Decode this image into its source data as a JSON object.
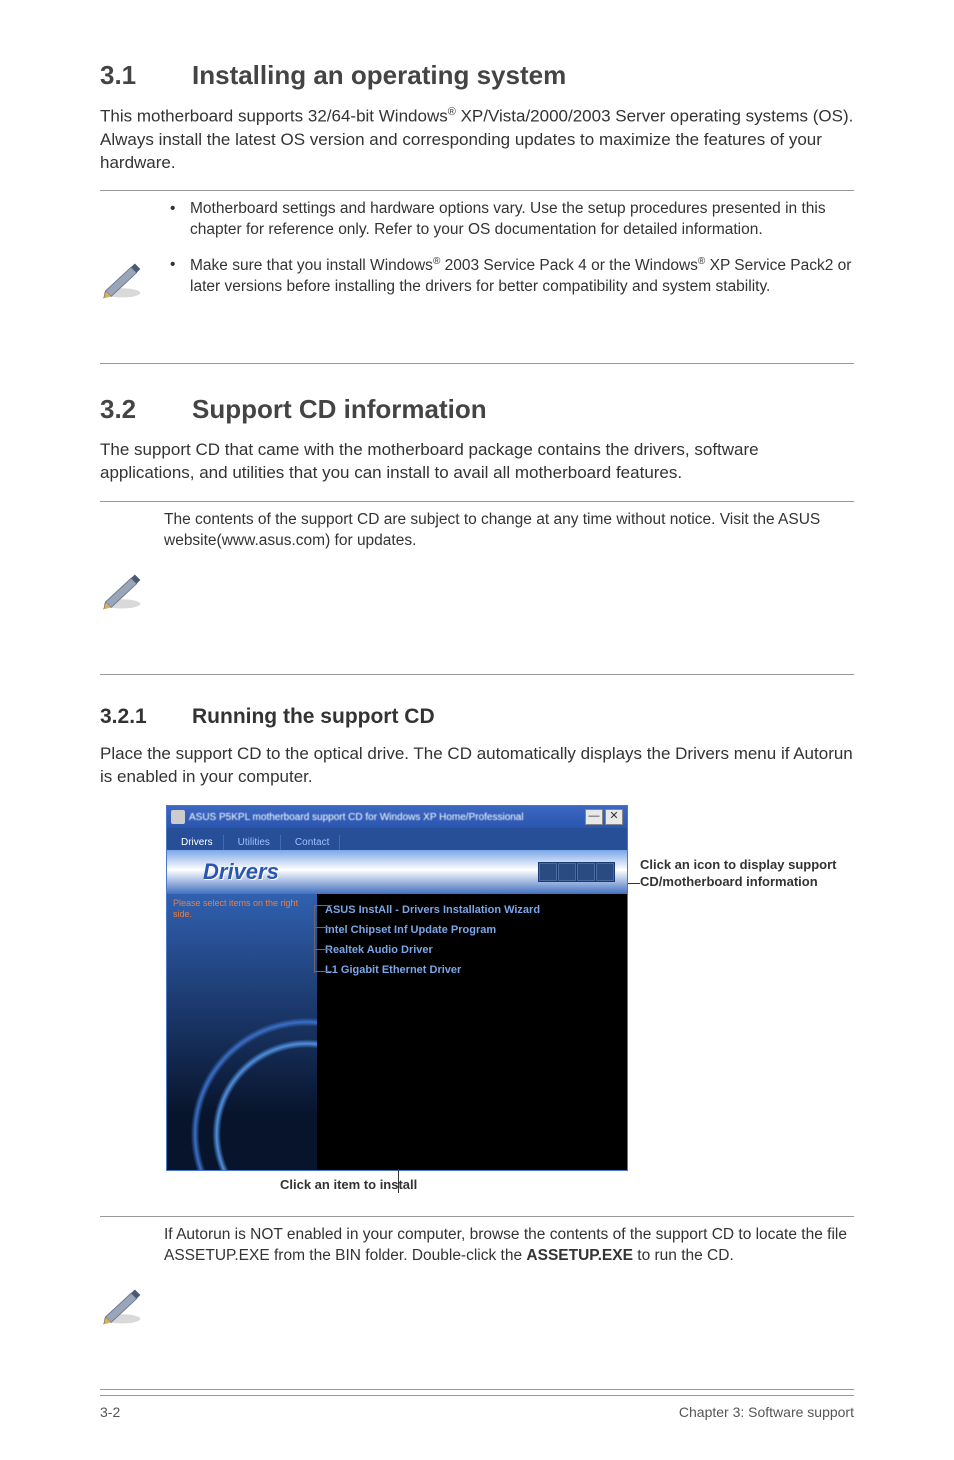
{
  "sec31": {
    "num": "3.1",
    "title": "Installing an operating system",
    "body_pre": "This motherboard supports 32/64-bit Windows",
    "body_post": " XP/Vista/2000/2003 Server operating systems (OS). Always install the latest OS version and corresponding updates to maximize the features of your hardware.",
    "note1": "Motherboard settings and hardware options vary. Use the setup procedures presented in this chapter for reference only. Refer to your OS documentation for detailed information.",
    "note2a": "Make sure that you install Windows",
    "note2b": " 2003 Service Pack 4 or the Windows",
    "note2c": " XP Service Pack2 or later versions before installing the drivers for better compatibility and system stability."
  },
  "sec32": {
    "num": "3.2",
    "title": "Support CD information",
    "body": "The support CD that came with the motherboard package contains the drivers, software applications, and utilities that you can install to avail all  motherboard features.",
    "note": "The contents of the support CD are subject to change at any time without notice. Visit the ASUS website(www.asus.com) for updates."
  },
  "sec321": {
    "num": "3.2.1",
    "title": "Running the support CD",
    "body": "Place the support CD to the optical drive. The CD automatically displays the Drivers menu if Autorun is enabled in your computer."
  },
  "window": {
    "title": "ASUS P5KPL motherboard support CD for Windows XP Home/Professional",
    "tabs": [
      "Drivers",
      "Utilities",
      "Contact"
    ],
    "banner": "Drivers",
    "left_prompt": "Please select items on the right side.",
    "items": [
      "ASUS InstAll - Drivers Installation Wizard",
      "Intel Chipset Inf Update Program",
      "Realtek Audio Driver",
      "L1 Gigabit Ethernet Driver"
    ]
  },
  "callouts": {
    "right": "Click an icon to display support CD/motherboard information",
    "bottom": "Click an item to install"
  },
  "autorun_note": {
    "a": "If Autorun is NOT enabled in your computer, browse the contents of the support CD to locate the file ASSETUP.EXE from the BIN folder. Double-click the ",
    "b": "ASSETUP.EXE",
    "c": " to run the CD."
  },
  "footer": {
    "left": "3-2",
    "right": "Chapter 3: Software support"
  }
}
